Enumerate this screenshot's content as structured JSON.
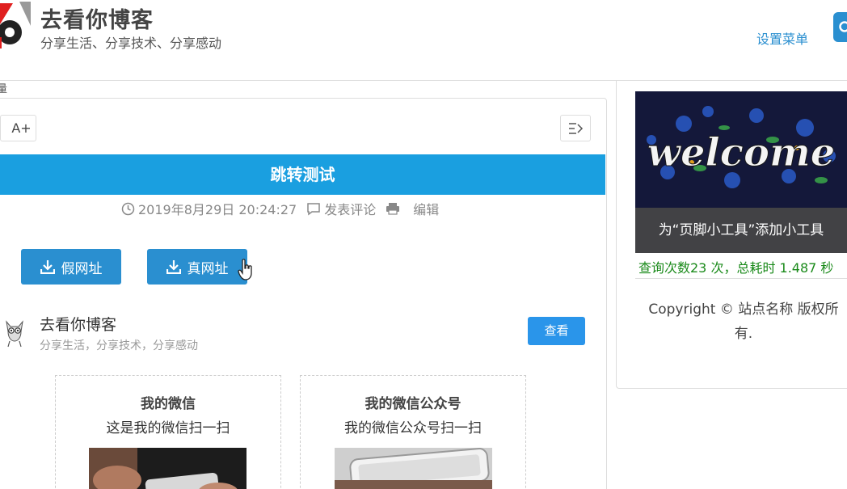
{
  "header": {
    "site_title": "去看你博客",
    "site_subtitle": "分享生活、分享技术、分享感动",
    "menu_link": "设置菜单"
  },
  "breadcrumb_fragment": "量",
  "toolbar": {
    "font_size_label": "A+"
  },
  "article": {
    "title": "跳转测试",
    "date": "2019年8月29日 20:24:27",
    "comment_label": "发表评论",
    "edit_label": "编辑",
    "buttons": [
      {
        "label": "假网址"
      },
      {
        "label": "真网址"
      }
    ]
  },
  "author": {
    "name": "去看你博客",
    "description": "分享生活，分享技术，分享感动",
    "view_label": "查看"
  },
  "qr_codes": [
    {
      "title": "我的微信",
      "description": "这是我的微信扫一扫"
    },
    {
      "title": "我的微信公众号",
      "description": "我的微信公众号扫一扫"
    }
  ],
  "sidebar": {
    "welcome_text": "welcome",
    "widget_caption": "为“页脚小工具”添加小工具",
    "stats": "查询次数23 次，总耗时 1.487 秒",
    "copyright": "Copyright ©  站点名称  版权所有."
  },
  "colors": {
    "primary": "#1a9fe0",
    "button": "#2a8fd0",
    "stats": "#1a8a1a"
  }
}
